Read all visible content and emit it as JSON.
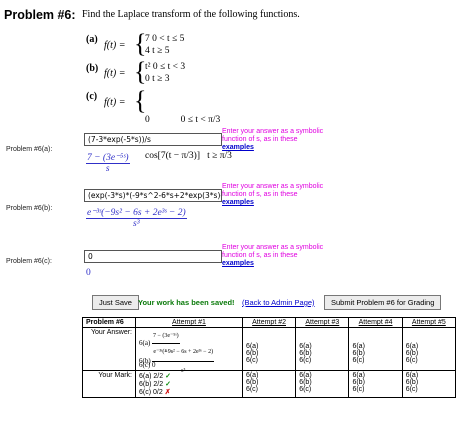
{
  "problem": {
    "title": "Problem #6:",
    "prompt": "Find the Laplace transform of the following functions."
  },
  "parts": {
    "a": {
      "label": "(a)",
      "lhs": "f(t) =",
      "case1": "7   0 < t ≤ 5",
      "case2": "4   t ≥ 5"
    },
    "b": {
      "label": "(b)",
      "lhs": "f(t) =",
      "case1": "t²   0 ≤ t < 3",
      "case2": "0   t ≥ 3"
    },
    "c": {
      "label": "(c)",
      "lhs": "f(t) =",
      "case1": "0             0 ≤ t < π/3",
      "case2": "cos[7(t − π/3)]   t ≥ π/3"
    }
  },
  "answers": [
    {
      "label": "Problem #6(a):",
      "value": "(7-3*exp(-5*s))/s",
      "preview_num": "7 − (3e⁻⁵ˢ)",
      "preview_den": "s"
    },
    {
      "label": "Problem #6(b):",
      "value": "(exp(-3*s)*(-9*s^2-6*s+2*exp(3*s)-",
      "preview_num": "e⁻³ˢ(−9s² − 6s + 2e³ˢ − 2)",
      "preview_den": "s³"
    },
    {
      "label": "Problem #6(c):",
      "value": "0",
      "preview_text": "0"
    }
  ],
  "hint": {
    "line1": "Enter your answer as a symbolic",
    "line2": "function of s, as in these",
    "link": "examples"
  },
  "actions": {
    "just_save": "Just Save",
    "saved_msg": "Your work has been saved!",
    "back_link": "(Back to Admin Page)",
    "submit": "Submit Problem #6 for Grading"
  },
  "attempts_table": {
    "header": [
      "Problem #6",
      "Attempt #1",
      "Attempt #2",
      "Attempt #3",
      "Attempt #4",
      "Attempt #5"
    ],
    "your_answer_label": "Your Answer:",
    "your_mark_label": "Your Mark:",
    "attempt1": {
      "a_label": "6(a)",
      "a_num": "7 − (3e⁻⁵ˢ)",
      "a_den": "s",
      "b_label": "6(b)",
      "b_num": "e⁻³ˢ(−9s² − 6s + 2e³ˢ − 2)",
      "b_den": "s³",
      "c_label": "6(c)",
      "c_val": "0"
    },
    "other_attempt_labels": [
      "6(a)",
      "6(b)",
      "6(c)"
    ],
    "marks": [
      {
        "text": "6(a) 2/2",
        "status": "✓"
      },
      {
        "text": "6(b) 2/2",
        "status": "✓"
      },
      {
        "text": "6(c) 0/2",
        "status": "✗"
      }
    ]
  }
}
